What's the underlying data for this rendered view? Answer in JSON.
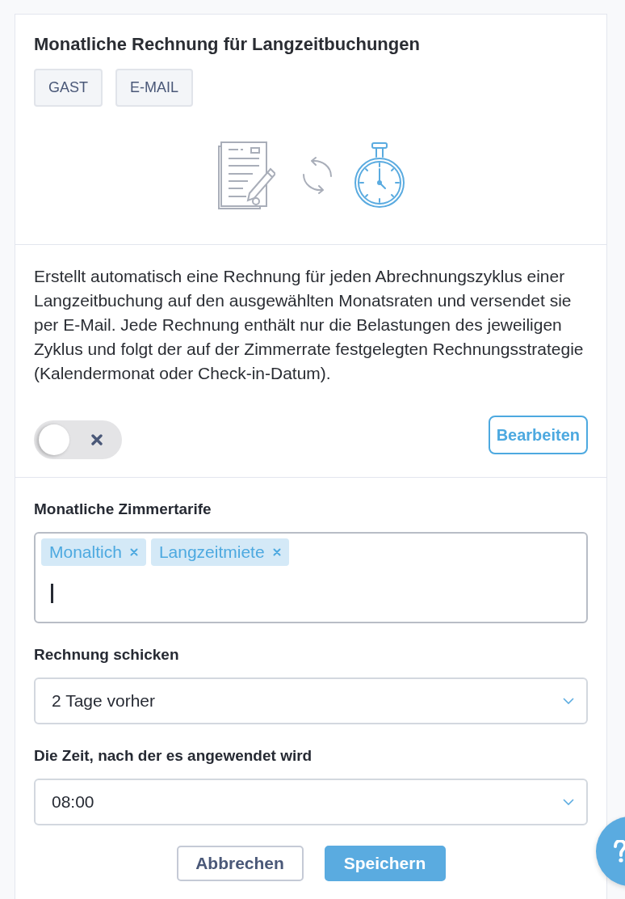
{
  "card": {
    "title": "Monatliche Rechnung für Langzeitbuchungen",
    "tags": [
      "GAST",
      "E-MAIL"
    ]
  },
  "description": {
    "text": "Erstellt automatisch eine Rechnung für jeden Abrechnungszyklus einer Langzeitbuchung auf den ausgewählten Monatsraten und versendet sie per E-Mail. Jede Rechnung enthält nur die Belastungen des jeweiligen Zyklus und folgt der auf der Zimmerrate festgelegten Rechnungsstrategie (Kalendermonat oder Check-in-Datum).",
    "toggle": {
      "on": false
    },
    "edit_button": "Bearbeiten"
  },
  "form": {
    "fields": [
      {
        "kind": "tags",
        "label": "Monatliche Zimmertarife",
        "tags": [
          "Monaltich",
          "Langzeitmiete"
        ],
        "focused": true
      },
      {
        "kind": "select",
        "label": "Rechnung schicken",
        "value": "2 Tage vorher"
      },
      {
        "kind": "select",
        "label": "Die Zeit, nach der es angewendet wird",
        "value": "08:00"
      }
    ],
    "buttons": [
      {
        "label": "Abbrechen",
        "kind": "secondary"
      },
      {
        "label": "Speichern",
        "kind": "primary"
      }
    ]
  }
}
